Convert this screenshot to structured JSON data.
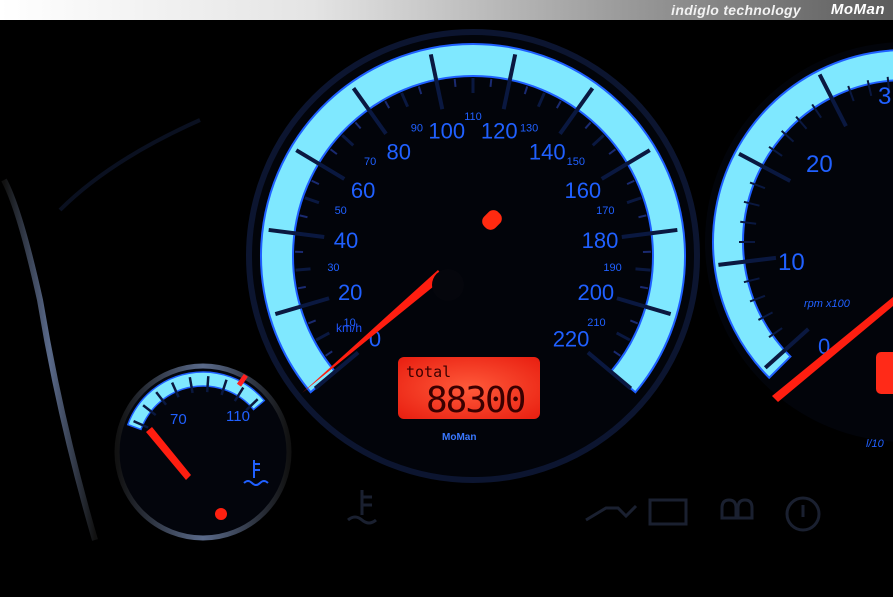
{
  "banner": {
    "tagline": "indiglo technology",
    "brand": "MoMan"
  },
  "speedometer": {
    "unit": "km/h",
    "major_labels": [
      "0",
      "20",
      "40",
      "60",
      "80",
      "100",
      "120",
      "140",
      "160",
      "180",
      "200",
      "220"
    ],
    "minor_labels": [
      "10",
      "30",
      "50",
      "70",
      "90",
      "110",
      "130",
      "150",
      "170",
      "190",
      "210"
    ],
    "odometer_caption": "total",
    "odometer_value": "88300",
    "brand_badge": "MoMan",
    "needle_value_kmh": 0
  },
  "tachometer": {
    "major_labels": [
      "10",
      "20",
      "3"
    ],
    "zero_label": "0",
    "unit": "rpm x100",
    "fuel_text": "l/10"
  },
  "temperature_gauge": {
    "labels": [
      "70",
      "110"
    ]
  },
  "colors": {
    "dial_glow": "#5ad6ff",
    "dial_deep": "#1a4dff",
    "scale_text": "#1f55ff",
    "needle": "#ff2010",
    "odometer_bg": "#ff3322",
    "odometer_text": "#3a0000",
    "background": "#000000"
  },
  "icons": [
    "coolant-temperature-icon",
    "oil-can-icon",
    "battery-icon",
    "glow-plug-icon",
    "brake-warning-icon"
  ]
}
